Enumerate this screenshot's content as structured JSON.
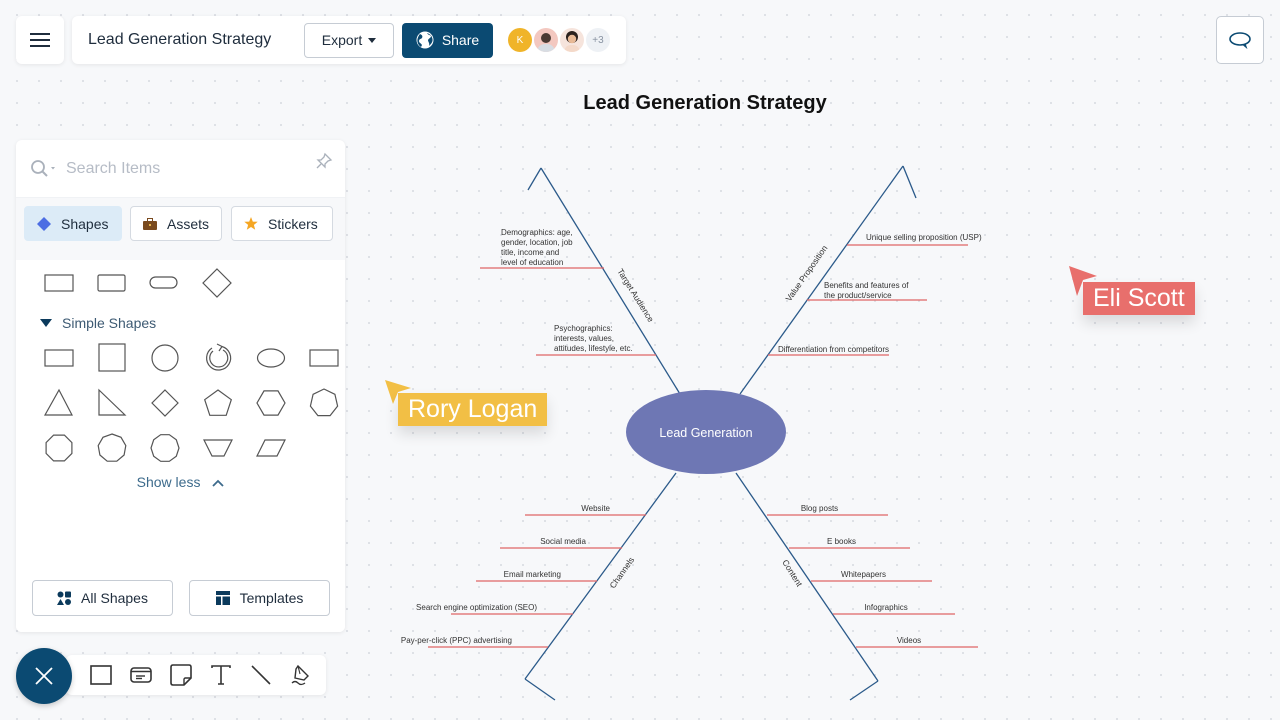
{
  "app": {
    "document_title": "Lead Generation Strategy",
    "export_label": "Export",
    "share_label": "Share",
    "collaborators": [
      {
        "type": "initial",
        "label": "K",
        "color": "#f0b429"
      },
      {
        "type": "photo",
        "label": ""
      },
      {
        "type": "photo",
        "label": ""
      }
    ],
    "more_collaborators": "+3"
  },
  "panel": {
    "search_placeholder": "Search Items",
    "tabs": [
      {
        "label": "Shapes",
        "icon": "diamond-icon",
        "active": true
      },
      {
        "label": "Assets",
        "icon": "briefcase-icon",
        "active": false
      },
      {
        "label": "Stickers",
        "icon": "star-icon",
        "active": false
      }
    ],
    "recent_shapes": [
      "rectangle",
      "rectangle",
      "rounded-rectangle",
      "diamond"
    ],
    "section_title": "Simple Shapes",
    "simple_shapes": [
      "rectangle",
      "square",
      "circle",
      "cycle",
      "ellipse",
      "rectangle-wide",
      "triangle",
      "right-triangle",
      "diamond",
      "pentagon",
      "hexagon",
      "heptagon",
      "octagon",
      "nonagon",
      "decagon",
      "trapezoid",
      "parallelogram"
    ],
    "show_less_label": "Show less",
    "all_shapes_label": "All Shapes",
    "templates_label": "Templates"
  },
  "toolbar": {
    "tools": [
      "rectangle-tool",
      "card-tool",
      "sticky-note-tool",
      "text-tool",
      "line-tool",
      "pen-tool"
    ]
  },
  "diagram": {
    "title": "Lead Generation Strategy",
    "center": "Lead Generation",
    "colors": {
      "spine": "#2b5a8a",
      "rib": "#e06666",
      "center": "#6e77b4"
    },
    "branches": [
      {
        "name": "Target Audience",
        "items": [
          "Demographics: age, gender, location, job title, income and level of education",
          "Psychographics: interests, values, attitudes, lifestyle, etc."
        ]
      },
      {
        "name": "Value Proposition",
        "items": [
          "Unique selling proposition (USP)",
          "Benefits and features of the product/service",
          "Differentiation from competitors"
        ]
      },
      {
        "name": "Channels",
        "items": [
          "Website",
          "Social media",
          "Email marketing",
          "Search engine optimization (SEO)",
          "Pay-per-click (PPC) advertising"
        ]
      },
      {
        "name": "Content",
        "items": [
          "Blog posts",
          "E books",
          "Whitepapers",
          "Infographics",
          "Videos"
        ]
      }
    ]
  },
  "cursors": [
    {
      "name": "Rory Logan",
      "color": "#f2bf45"
    },
    {
      "name": "Eli Scott",
      "color": "#e86f6c"
    }
  ]
}
